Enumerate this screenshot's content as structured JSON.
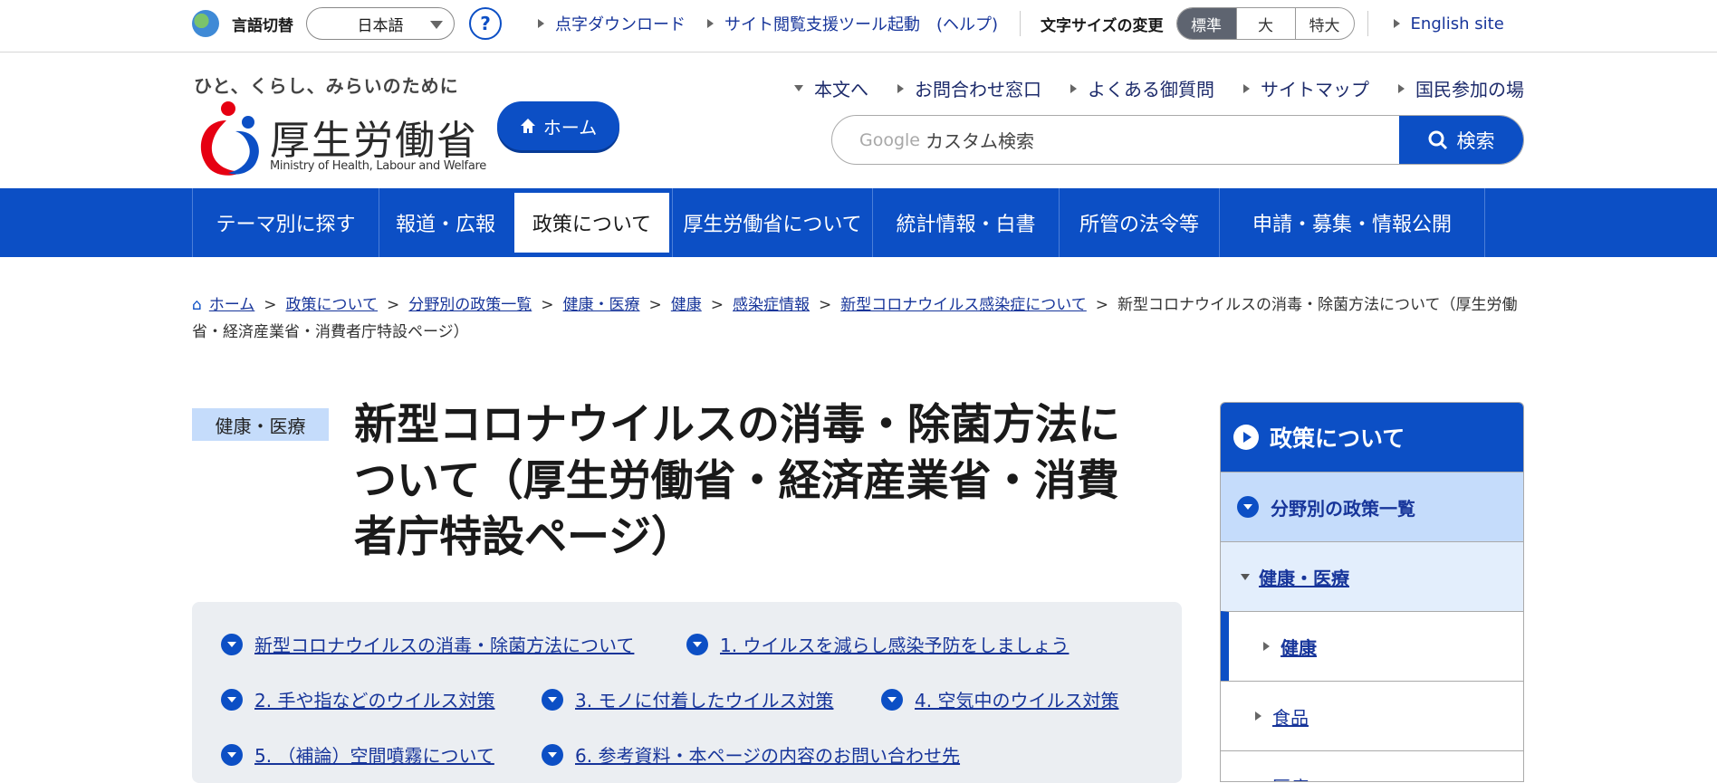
{
  "utility": {
    "lang_label": "言語切替",
    "lang_value": "日本語",
    "help": "?",
    "links": [
      "点字ダウンロード",
      "サイト閲覧支援ツール起動　(ヘルプ)"
    ],
    "font_size_label": "文字サイズの変更",
    "font_sizes": [
      "標準",
      "大",
      "特大"
    ],
    "english": "English site"
  },
  "header": {
    "tagline": "ひと、くらし、みらいのために",
    "logo_name": "厚生労働省",
    "logo_en": "Ministry of Health, Labour and Welfare",
    "home_button": "ホーム",
    "links": [
      "本文へ",
      "お問合わせ窓口",
      "よくある御質問",
      "サイトマップ",
      "国民参加の場"
    ],
    "search_brand": "Google",
    "search_placeholder": "カスタム検索",
    "search_button": "検索"
  },
  "global_nav": [
    "テーマ別に探す",
    "報道・広報",
    "政策について",
    "厚生労働省について",
    "統計情報・白書",
    "所管の法令等",
    "申請・募集・情報公開"
  ],
  "breadcrumb": {
    "links": [
      "ホーム",
      "政策について",
      "分野別の政策一覧",
      "健康・医療",
      "健康",
      "感染症情報",
      "新型コロナウイルス感染症について"
    ],
    "current": "新型コロナウイルスの消毒・除菌方法について（厚生労働省・経済産業省・消費者庁特設ページ）"
  },
  "main": {
    "badge": "健康・医療",
    "title": "新型コロナウイルスの消毒・除菌方法について（厚生労働省・経済産業省・消費者庁特設ページ）",
    "toc": [
      "新型コロナウイルスの消毒・除菌方法について",
      "1. ウイルスを減らし感染予防をしましょう",
      "2. 手や指などのウイルス対策",
      "3. モノに付着したウイルス対策",
      "4. 空気中のウイルス対策",
      "5. （補論）空間噴霧について",
      "6. 参考資料・本ページの内容のお問い合わせ先"
    ]
  },
  "side": {
    "title": "政策について",
    "items": [
      "分野別の政策一覧",
      "健康・医療",
      "健康",
      "食品",
      "医療"
    ]
  },
  "colors": {
    "brand": "#0c4fc5",
    "badge": "#c5dcfb",
    "toc_bg": "#ebeef2"
  }
}
